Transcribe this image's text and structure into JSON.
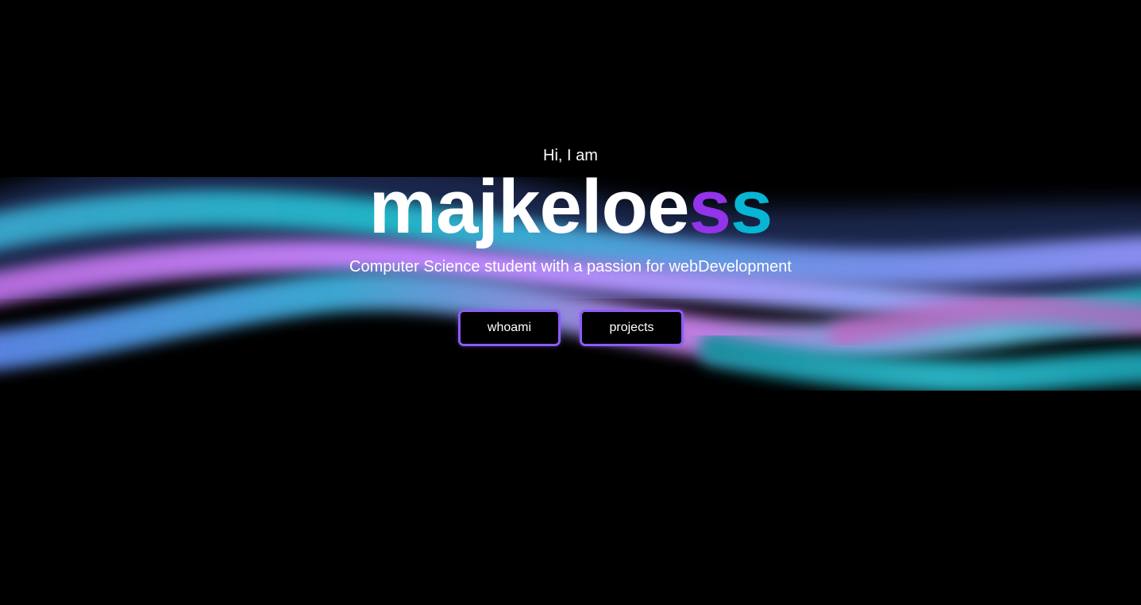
{
  "hero": {
    "greeting": "Hi, I am",
    "name_prefix": "majkeloe",
    "name_s1": "s",
    "name_s2": "s",
    "tagline": "Computer Science student with a passion for webDevelopment"
  },
  "buttons": {
    "whoami": "whoami",
    "projects": "projects"
  },
  "colors": {
    "background": "#000000",
    "text": "#ffffff",
    "accent_purple": "#9333ea",
    "accent_cyan": "#06b6d4",
    "button_border": "#8b5cf6",
    "wave_cyan": "#14b8c8",
    "wave_pink": "#c084fc",
    "wave_blue": "#60a5fa"
  }
}
